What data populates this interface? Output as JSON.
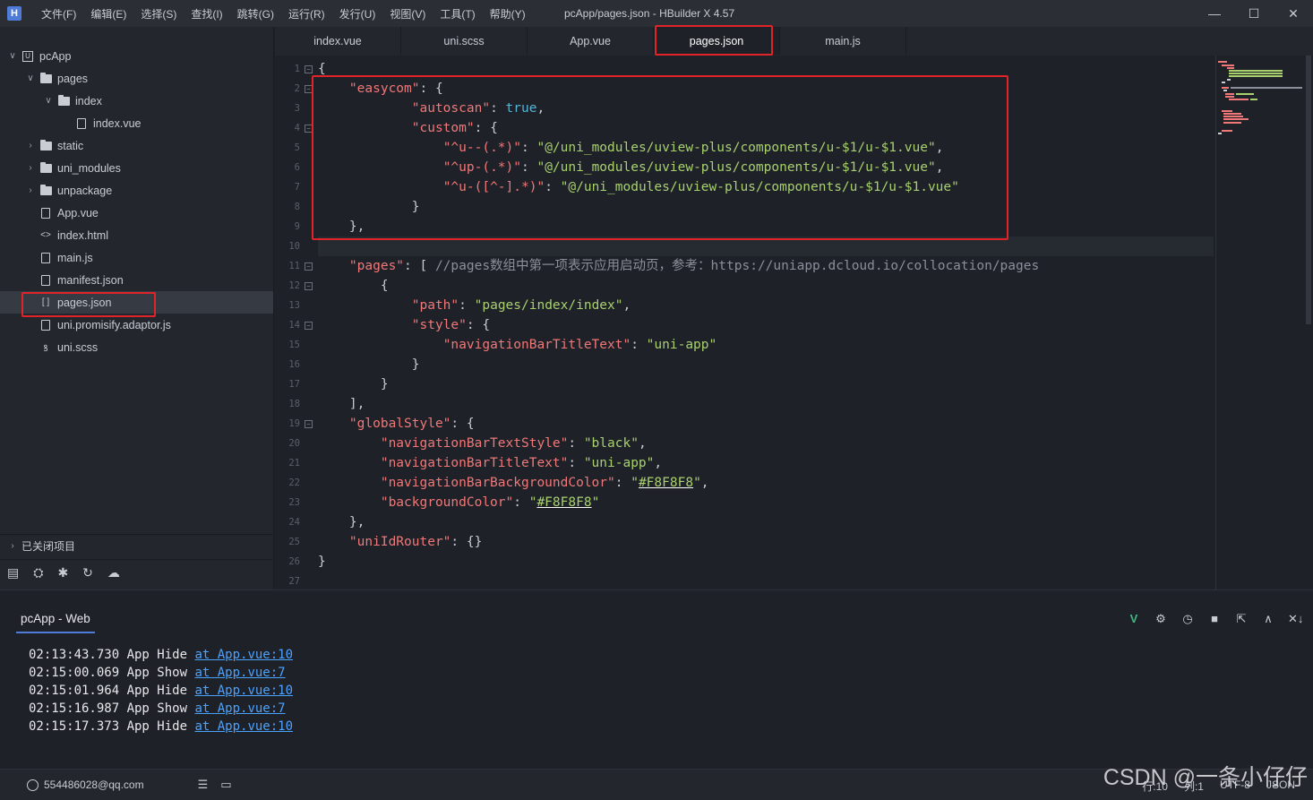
{
  "window": {
    "title": "pcApp/pages.json - HBuilder X 4.57",
    "menu": [
      "文件(F)",
      "编辑(E)",
      "选择(S)",
      "查找(I)",
      "跳转(G)",
      "运行(R)",
      "发行(U)",
      "视图(V)",
      "工具(T)",
      "帮助(Y)"
    ],
    "controls": {
      "minimize": "—",
      "maximize": "☐",
      "close": "✕"
    }
  },
  "explorer": {
    "items": [
      {
        "label": "pcApp",
        "icon": "project-icon",
        "chevron": "∨"
      },
      {
        "label": "pages",
        "icon": "folder-icon",
        "chevron": "∨"
      },
      {
        "label": "index",
        "icon": "folder-icon",
        "chevron": "∨"
      },
      {
        "label": "index.vue",
        "icon": "vue-file-icon",
        "chevron": ""
      },
      {
        "label": "static",
        "icon": "folder-icon",
        "chevron": "›"
      },
      {
        "label": "uni_modules",
        "icon": "folder-icon",
        "chevron": "›"
      },
      {
        "label": "unpackage",
        "icon": "folder-icon",
        "chevron": "›"
      },
      {
        "label": "App.vue",
        "icon": "vue-file-icon",
        "chevron": ""
      },
      {
        "label": "index.html",
        "icon": "html-file-icon",
        "chevron": ""
      },
      {
        "label": "main.js",
        "icon": "js-file-icon",
        "chevron": ""
      },
      {
        "label": "manifest.json",
        "icon": "manifest-file-icon",
        "chevron": ""
      },
      {
        "label": "pages.json",
        "icon": "json-file-icon",
        "chevron": ""
      },
      {
        "label": "uni.promisify.adaptor.js",
        "icon": "js-file-icon",
        "chevron": ""
      },
      {
        "label": "uni.scss",
        "icon": "scss-file-icon",
        "chevron": ""
      }
    ],
    "selected": "pages.json",
    "closed_projects": "已关闭项目"
  },
  "tabs": [
    "index.vue",
    "uni.scss",
    "App.vue",
    "pages.json",
    "main.js"
  ],
  "active_tab": "pages.json",
  "editor": {
    "line_numbers": [
      "1",
      "2",
      "3",
      "4",
      "5",
      "6",
      "7",
      "8",
      "9",
      "10",
      "11",
      "12",
      "13",
      "14",
      "15",
      "16",
      "17",
      "18",
      "19",
      "20",
      "21",
      "22",
      "23",
      "24",
      "25",
      "26",
      "27"
    ],
    "lines": [
      [
        [
          "p",
          "{"
        ]
      ],
      [
        [
          "p",
          "    "
        ],
        [
          "k",
          "\"easycom\""
        ],
        [
          "p",
          ": {"
        ]
      ],
      [
        [
          "p",
          "            "
        ],
        [
          "k",
          "\"autoscan\""
        ],
        [
          "p",
          ": "
        ],
        [
          "b",
          "true"
        ],
        [
          "p",
          ","
        ]
      ],
      [
        [
          "p",
          "            "
        ],
        [
          "k",
          "\"custom\""
        ],
        [
          "p",
          ": {"
        ]
      ],
      [
        [
          "p",
          "                "
        ],
        [
          "k",
          "\"^u--(.*)\""
        ],
        [
          "p",
          ": "
        ],
        [
          "s",
          "\"@/uni_modules/uview-plus/components/u-$1/u-$1.vue\""
        ],
        [
          "p",
          ","
        ]
      ],
      [
        [
          "p",
          "                "
        ],
        [
          "k",
          "\"^up-(.*)\""
        ],
        [
          "p",
          ": "
        ],
        [
          "s",
          "\"@/uni_modules/uview-plus/components/u-$1/u-$1.vue\""
        ],
        [
          "p",
          ","
        ]
      ],
      [
        [
          "p",
          "                "
        ],
        [
          "k",
          "\"^u-([^-].*)\""
        ],
        [
          "p",
          ": "
        ],
        [
          "s",
          "\"@/uni_modules/uview-plus/components/u-$1/u-$1.vue\""
        ]
      ],
      [
        [
          "p",
          "            }"
        ]
      ],
      [
        [
          "p",
          "    },"
        ]
      ],
      [
        [
          "p",
          ""
        ]
      ],
      [
        [
          "p",
          "    "
        ],
        [
          "k",
          "\"pages\""
        ],
        [
          "p",
          ": [ "
        ],
        [
          "c",
          "//pages数组中第一项表示应用启动页，参考：https://uniapp.dcloud.io/collocation/pages"
        ]
      ],
      [
        [
          "p",
          "        {"
        ]
      ],
      [
        [
          "p",
          "            "
        ],
        [
          "k",
          "\"path\""
        ],
        [
          "p",
          ": "
        ],
        [
          "s",
          "\"pages/index/index\""
        ],
        [
          "p",
          ","
        ]
      ],
      [
        [
          "p",
          "            "
        ],
        [
          "k",
          "\"style\""
        ],
        [
          "p",
          ": {"
        ]
      ],
      [
        [
          "p",
          "                "
        ],
        [
          "k",
          "\"navigationBarTitleText\""
        ],
        [
          "p",
          ": "
        ],
        [
          "s",
          "\"uni-app\""
        ]
      ],
      [
        [
          "p",
          "            }"
        ]
      ],
      [
        [
          "p",
          "        }"
        ]
      ],
      [
        [
          "p",
          "    ],"
        ]
      ],
      [
        [
          "p",
          "    "
        ],
        [
          "k",
          "\"globalStyle\""
        ],
        [
          "p",
          ": {"
        ]
      ],
      [
        [
          "p",
          "        "
        ],
        [
          "k",
          "\"navigationBarTextStyle\""
        ],
        [
          "p",
          ": "
        ],
        [
          "s",
          "\"black\""
        ],
        [
          "p",
          ","
        ]
      ],
      [
        [
          "p",
          "        "
        ],
        [
          "k",
          "\"navigationBarTitleText\""
        ],
        [
          "p",
          ": "
        ],
        [
          "s",
          "\"uni-app\""
        ],
        [
          "p",
          ","
        ]
      ],
      [
        [
          "p",
          "        "
        ],
        [
          "k",
          "\"navigationBarBackgroundColor\""
        ],
        [
          "p",
          ": "
        ],
        [
          "s",
          "\""
        ],
        [
          "u",
          "#F8F8F8"
        ],
        [
          "s",
          "\""
        ],
        [
          "p",
          ","
        ]
      ],
      [
        [
          "p",
          "        "
        ],
        [
          "k",
          "\"backgroundColor\""
        ],
        [
          "p",
          ": "
        ],
        [
          "s",
          "\""
        ],
        [
          "u",
          "#F8F8F8"
        ],
        [
          "s",
          "\""
        ]
      ],
      [
        [
          "p",
          "    },"
        ]
      ],
      [
        [
          "p",
          "    "
        ],
        [
          "k",
          "\"uniIdRouter\""
        ],
        [
          "p",
          ": {}"
        ]
      ],
      [
        [
          "p",
          "}"
        ]
      ],
      [
        [
          "p",
          ""
        ]
      ]
    ],
    "fold_markers": [
      1,
      2,
      4,
      11,
      12,
      14,
      19
    ]
  },
  "console": {
    "tab_label": "pcApp - Web",
    "tools": [
      "V",
      "⚙",
      "◷",
      "■",
      "⇱",
      "∧",
      "✕↓"
    ],
    "logs": [
      {
        "time": "02:13:43.730",
        "msg": "App Hide",
        "link": "at App.vue:10"
      },
      {
        "time": "02:15:00.069",
        "msg": "App Show",
        "link": "at App.vue:7"
      },
      {
        "time": "02:15:01.964",
        "msg": "App Hide",
        "link": "at App.vue:10"
      },
      {
        "time": "02:15:16.987",
        "msg": "App Show",
        "link": "at App.vue:7"
      },
      {
        "time": "02:15:17.373",
        "msg": "App Hide",
        "link": "at App.vue:10"
      }
    ]
  },
  "statusbar": {
    "user": "554486028@qq.com",
    "line": "行:10",
    "col": "列:1",
    "encoding": "UTF-8",
    "language": "JSON"
  },
  "watermark": "CSDN @一条小仔仔",
  "colors": {
    "highlight": "#e0242a",
    "key": "#f07878",
    "string": "#a8d16e",
    "bool": "#57b6d8",
    "comment": "#8a8f9a",
    "link": "#4aa3ff"
  }
}
